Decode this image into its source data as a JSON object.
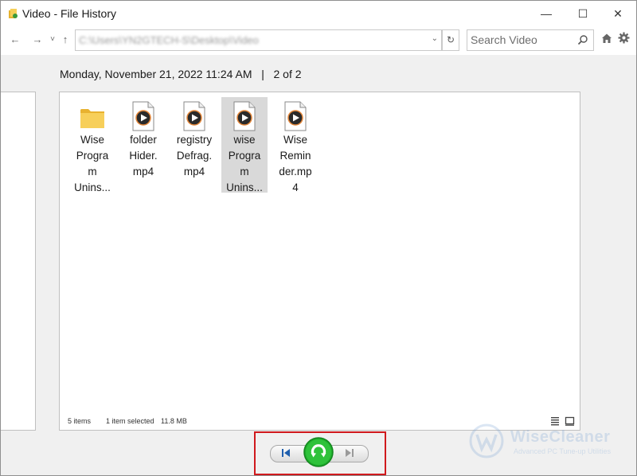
{
  "window": {
    "title": "Video - File History",
    "minimize_glyph": "—",
    "maximize_glyph": "☐",
    "close_glyph": "✕"
  },
  "toolbar": {
    "back_glyph": "←",
    "forward_glyph": "→",
    "recent_glyph": "˅",
    "up_glyph": "↑",
    "address": "C:\\Users\\YN2GTECH-S\\Desktop\\Video",
    "address_dropdown_glyph": "⌄",
    "refresh_glyph": "↻",
    "search_placeholder": "Search Video"
  },
  "header": {
    "date": "Monday, November 21, 2022 11:24 AM",
    "separator": "|",
    "position": "2 of 2"
  },
  "files": [
    {
      "label": "Wise Program Unins...",
      "lines": [
        "Wise",
        "Progra",
        "m",
        "Unins..."
      ],
      "icon": "folder-icon",
      "selected": false
    },
    {
      "label": "folder Hider.mp4",
      "lines": [
        "folder",
        "Hider.",
        "mp4"
      ],
      "icon": "video-file-icon",
      "selected": false
    },
    {
      "label": "registry Defrag.mp4",
      "lines": [
        "registry",
        "Defrag.",
        "mp4"
      ],
      "icon": "video-file-icon",
      "selected": false
    },
    {
      "label": "wise Program Unins...",
      "lines": [
        "wise",
        "Progra",
        "m",
        "Unins..."
      ],
      "icon": "video-file-icon",
      "selected": true
    },
    {
      "label": "Wise Reminder.mp4",
      "lines": [
        "Wise",
        "Remin",
        "der.mp",
        "4"
      ],
      "icon": "video-file-icon",
      "selected": false
    }
  ],
  "status": {
    "items_count": "5 items",
    "selection": "1 item selected",
    "size": "11.8 MB"
  },
  "watermark": {
    "name": "WiseCleaner",
    "tagline": "Advanced PC Tune-up Utilities"
  },
  "colors": {
    "highlight_box": "#d0191d",
    "restore_green": "#1fae2c",
    "nav_blue": "#1f5fae",
    "folder_yellow": "#f4c542"
  }
}
